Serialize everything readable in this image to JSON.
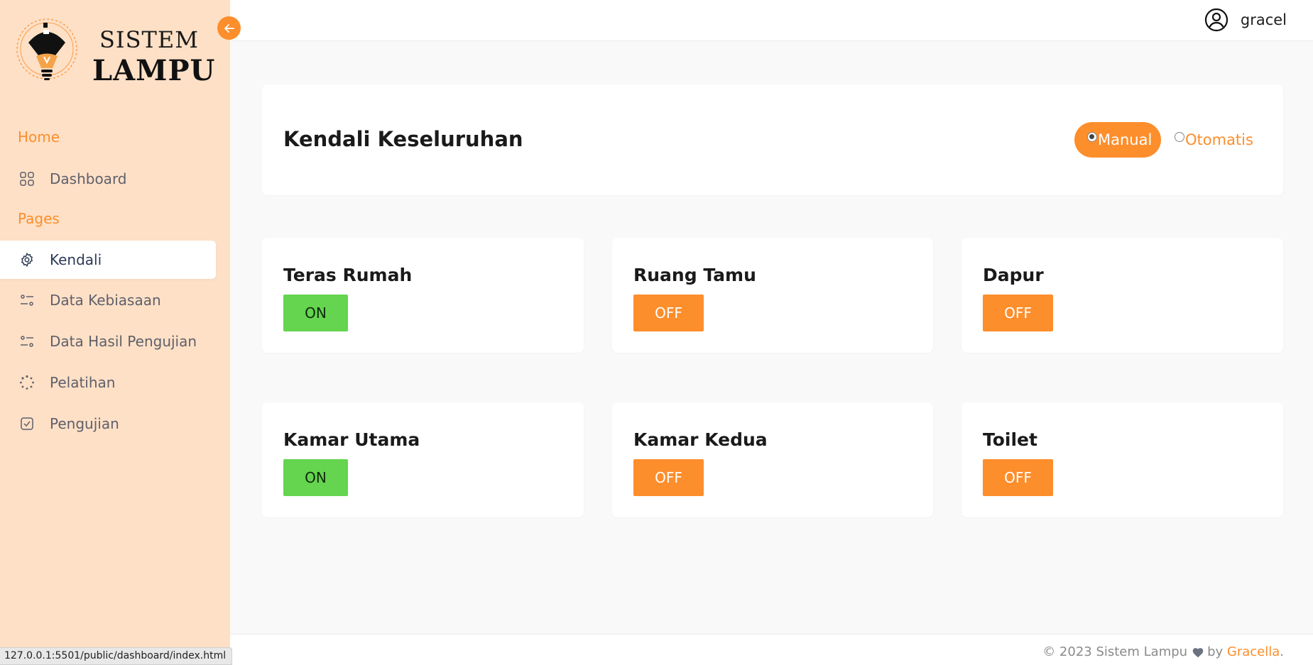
{
  "brand": {
    "line1": "SISTEM",
    "line2": "LAMPU"
  },
  "sidebar": {
    "heading_home": "Home",
    "heading_pages": "Pages",
    "items": [
      {
        "label": "Dashboard",
        "icon": "grid-icon"
      },
      {
        "label": "Kendali",
        "icon": "gear-icon",
        "active": true
      },
      {
        "label": "Data Kebiasaan",
        "icon": "sliders-icon"
      },
      {
        "label": "Data Hasil Pengujian",
        "icon": "sliders-icon"
      },
      {
        "label": "Pelatihan",
        "icon": "loader-icon"
      },
      {
        "label": "Pengujian",
        "icon": "check-square-icon"
      }
    ]
  },
  "header": {
    "username": "gracel"
  },
  "control": {
    "title": "Kendali Keseluruhan",
    "mode_manual": "Manual",
    "mode_auto": "Otomatis",
    "selected_mode": "Manual"
  },
  "rooms": [
    {
      "name": "Teras Rumah",
      "state": "ON"
    },
    {
      "name": "Ruang Tamu",
      "state": "OFF"
    },
    {
      "name": "Dapur",
      "state": "OFF"
    },
    {
      "name": "Kamar Utama",
      "state": "ON"
    },
    {
      "name": "Kamar Kedua",
      "state": "OFF"
    },
    {
      "name": "Toilet",
      "state": "OFF"
    }
  ],
  "footer": {
    "prefix": "© 2023 Sistem Lampu",
    "by": "by",
    "author": "Gracella",
    "suffix": "."
  },
  "statusbar": {
    "url": "127.0.0.1:5501/public/dashboard/index.html"
  },
  "colors": {
    "accent": "#fd8e2c",
    "on": "#65d44f",
    "sidebar_bg": "#fde0c6"
  }
}
